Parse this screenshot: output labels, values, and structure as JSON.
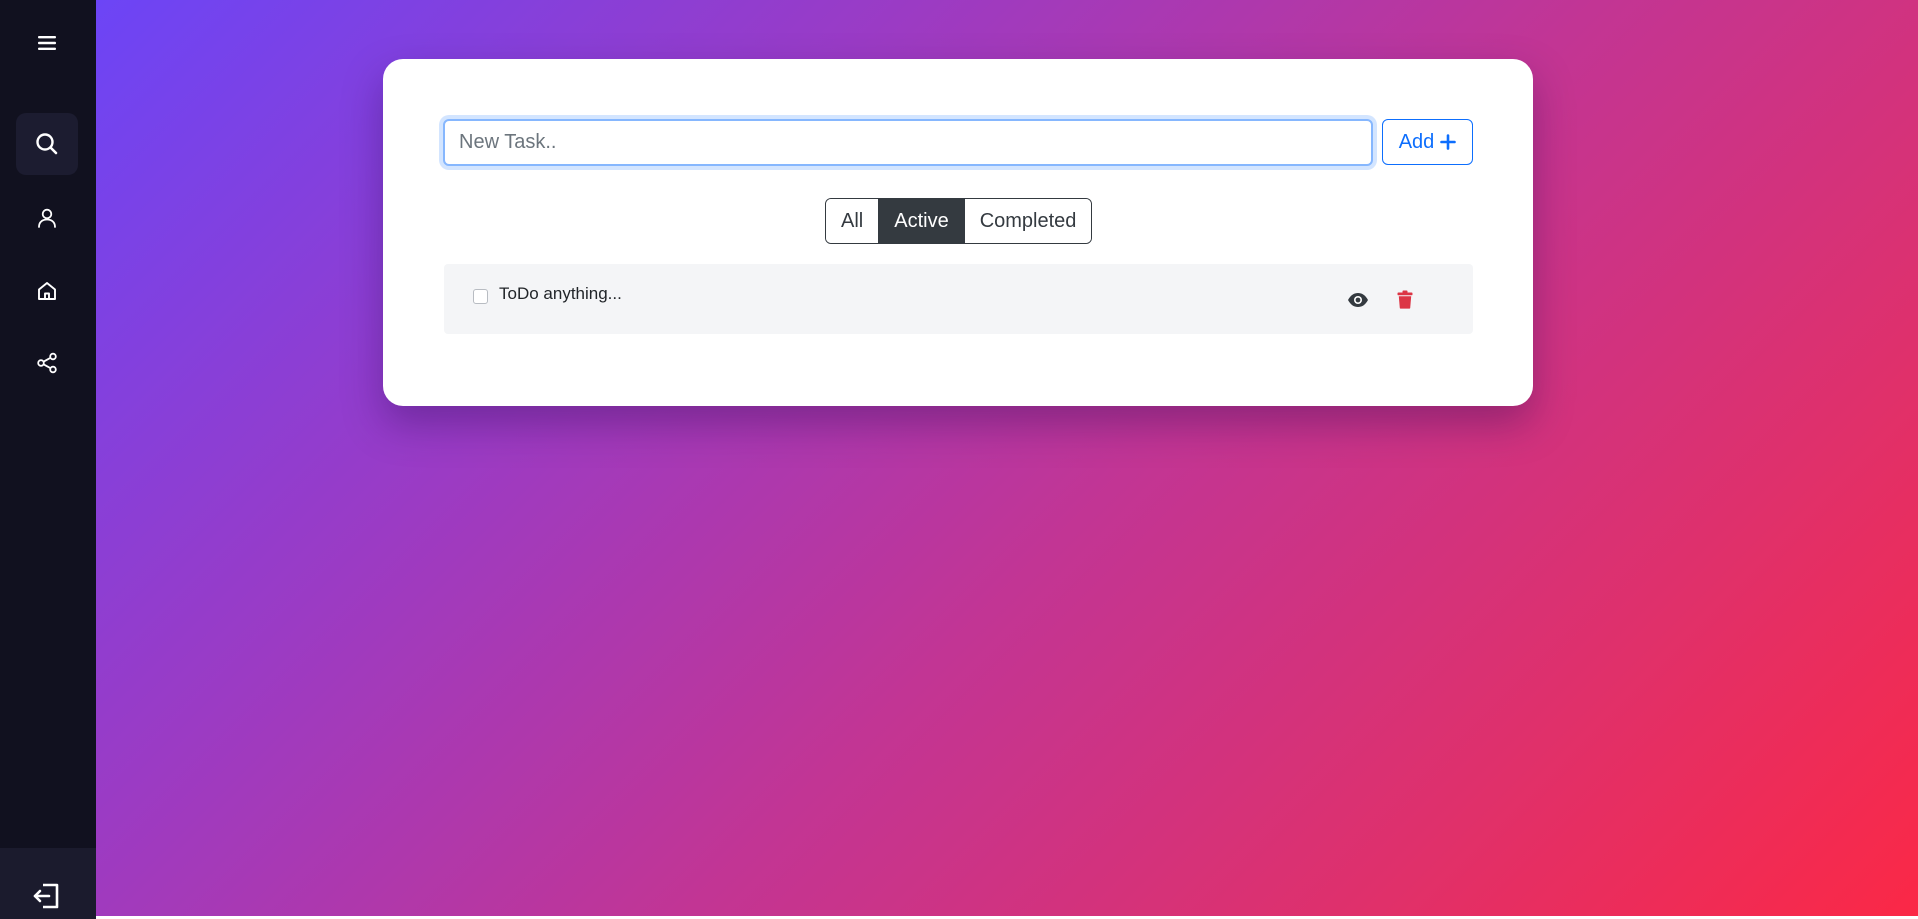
{
  "sidebar": {
    "items": [
      {
        "icon": "menu-icon"
      },
      {
        "icon": "search-icon",
        "active": true
      },
      {
        "icon": "user-icon"
      },
      {
        "icon": "home-icon"
      },
      {
        "icon": "share-icon"
      }
    ],
    "logout_icon": "logout-icon"
  },
  "task_form": {
    "input_value": "",
    "input_placeholder": "New Task..",
    "add_label": "Add"
  },
  "filters": {
    "options": [
      "All",
      "Active",
      "Completed"
    ],
    "selected": "Active"
  },
  "tasks": [
    {
      "text": "ToDo anything...",
      "completed": false
    }
  ],
  "colors": {
    "sidebar_bg": "#11111f",
    "gradient_start": "#6c45f6",
    "gradient_end": "#fb2846",
    "accent": "#0d6efd",
    "filter_active": "#343a40",
    "delete": "#dc3545"
  }
}
